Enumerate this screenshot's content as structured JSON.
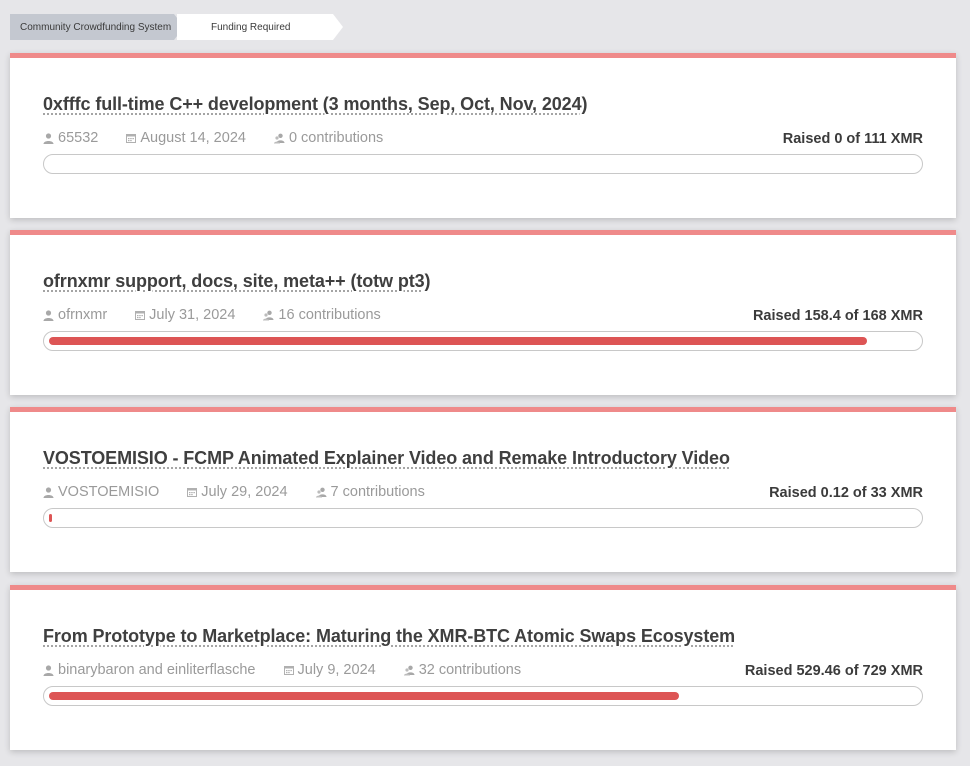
{
  "breadcrumb": {
    "items": [
      "Community Crowdfunding System",
      "Funding Required"
    ]
  },
  "colors": {
    "accent": "#ef8a8a",
    "progress_fill": "#dd5555"
  },
  "proposals": [
    {
      "title": "0xfffc full-time C++ development (3 months, Sep, Oct, Nov, 2024)",
      "author": "65532",
      "date": "August 14, 2024",
      "contributions": "0 contributions",
      "raised_text": "Raised 0 of 111 XMR",
      "raised": 0,
      "goal": 111
    },
    {
      "title": "ofrnxmr support, docs, site, meta++ (totw pt3)",
      "author": "ofrnxmr",
      "date": "July 31, 2024",
      "contributions": "16 contributions",
      "raised_text": "Raised 158.4 of 168 XMR",
      "raised": 158.4,
      "goal": 168
    },
    {
      "title": "VOSTOEMISIO - FCMP Animated Explainer Video and Remake Introductory Video",
      "author": "VOSTOEMISIO",
      "date": "July 29, 2024",
      "contributions": "7 contributions",
      "raised_text": "Raised 0.12 of 33 XMR",
      "raised": 0.12,
      "goal": 33
    },
    {
      "title": "From Prototype to Marketplace: Maturing the XMR-BTC Atomic Swaps Ecosystem",
      "author": "binarybaron and einliterflasche",
      "date": "July 9, 2024",
      "contributions": "32 contributions",
      "raised_text": "Raised 529.46 of 729 XMR",
      "raised": 529.46,
      "goal": 729
    }
  ],
  "icons": {
    "author": "user-icon",
    "date": "calendar-icon",
    "contributions": "contributors-icon"
  }
}
